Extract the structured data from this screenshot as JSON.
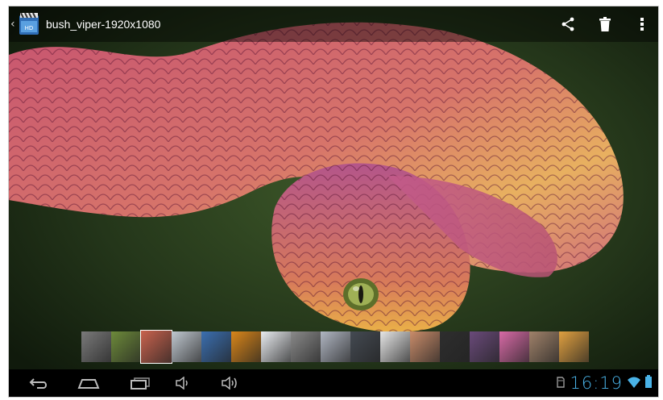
{
  "action_bar": {
    "title": "bush_viper-1920x1080",
    "icons": [
      "back-chevron",
      "gallery-app-icon",
      "share-icon",
      "delete-icon",
      "overflow-menu-icon"
    ]
  },
  "filmstrip": {
    "selected_index": 2,
    "thumb_colors": [
      "#7a7a7a",
      "#6d8a3a",
      "#c9634e",
      "#c0c8d0",
      "#3b6fb0",
      "#d9861a",
      "#e9ecf0",
      "#8a8a8a",
      "#b0b6c2",
      "#444a52",
      "#e6e6e6",
      "#c98c6a",
      "#2e2e2e",
      "#6a4a7a",
      "#d86aa6",
      "#a0826a",
      "#e0a040"
    ]
  },
  "nav_bar": {
    "icons": [
      "back-icon",
      "home-icon",
      "recent-apps-icon",
      "volume-down-icon",
      "volume-up-icon"
    ]
  },
  "status_bar": {
    "time": "16:19",
    "icons": [
      "sd-card-icon",
      "wifi-icon",
      "battery-icon"
    ],
    "accent": "#4ab3e8"
  }
}
